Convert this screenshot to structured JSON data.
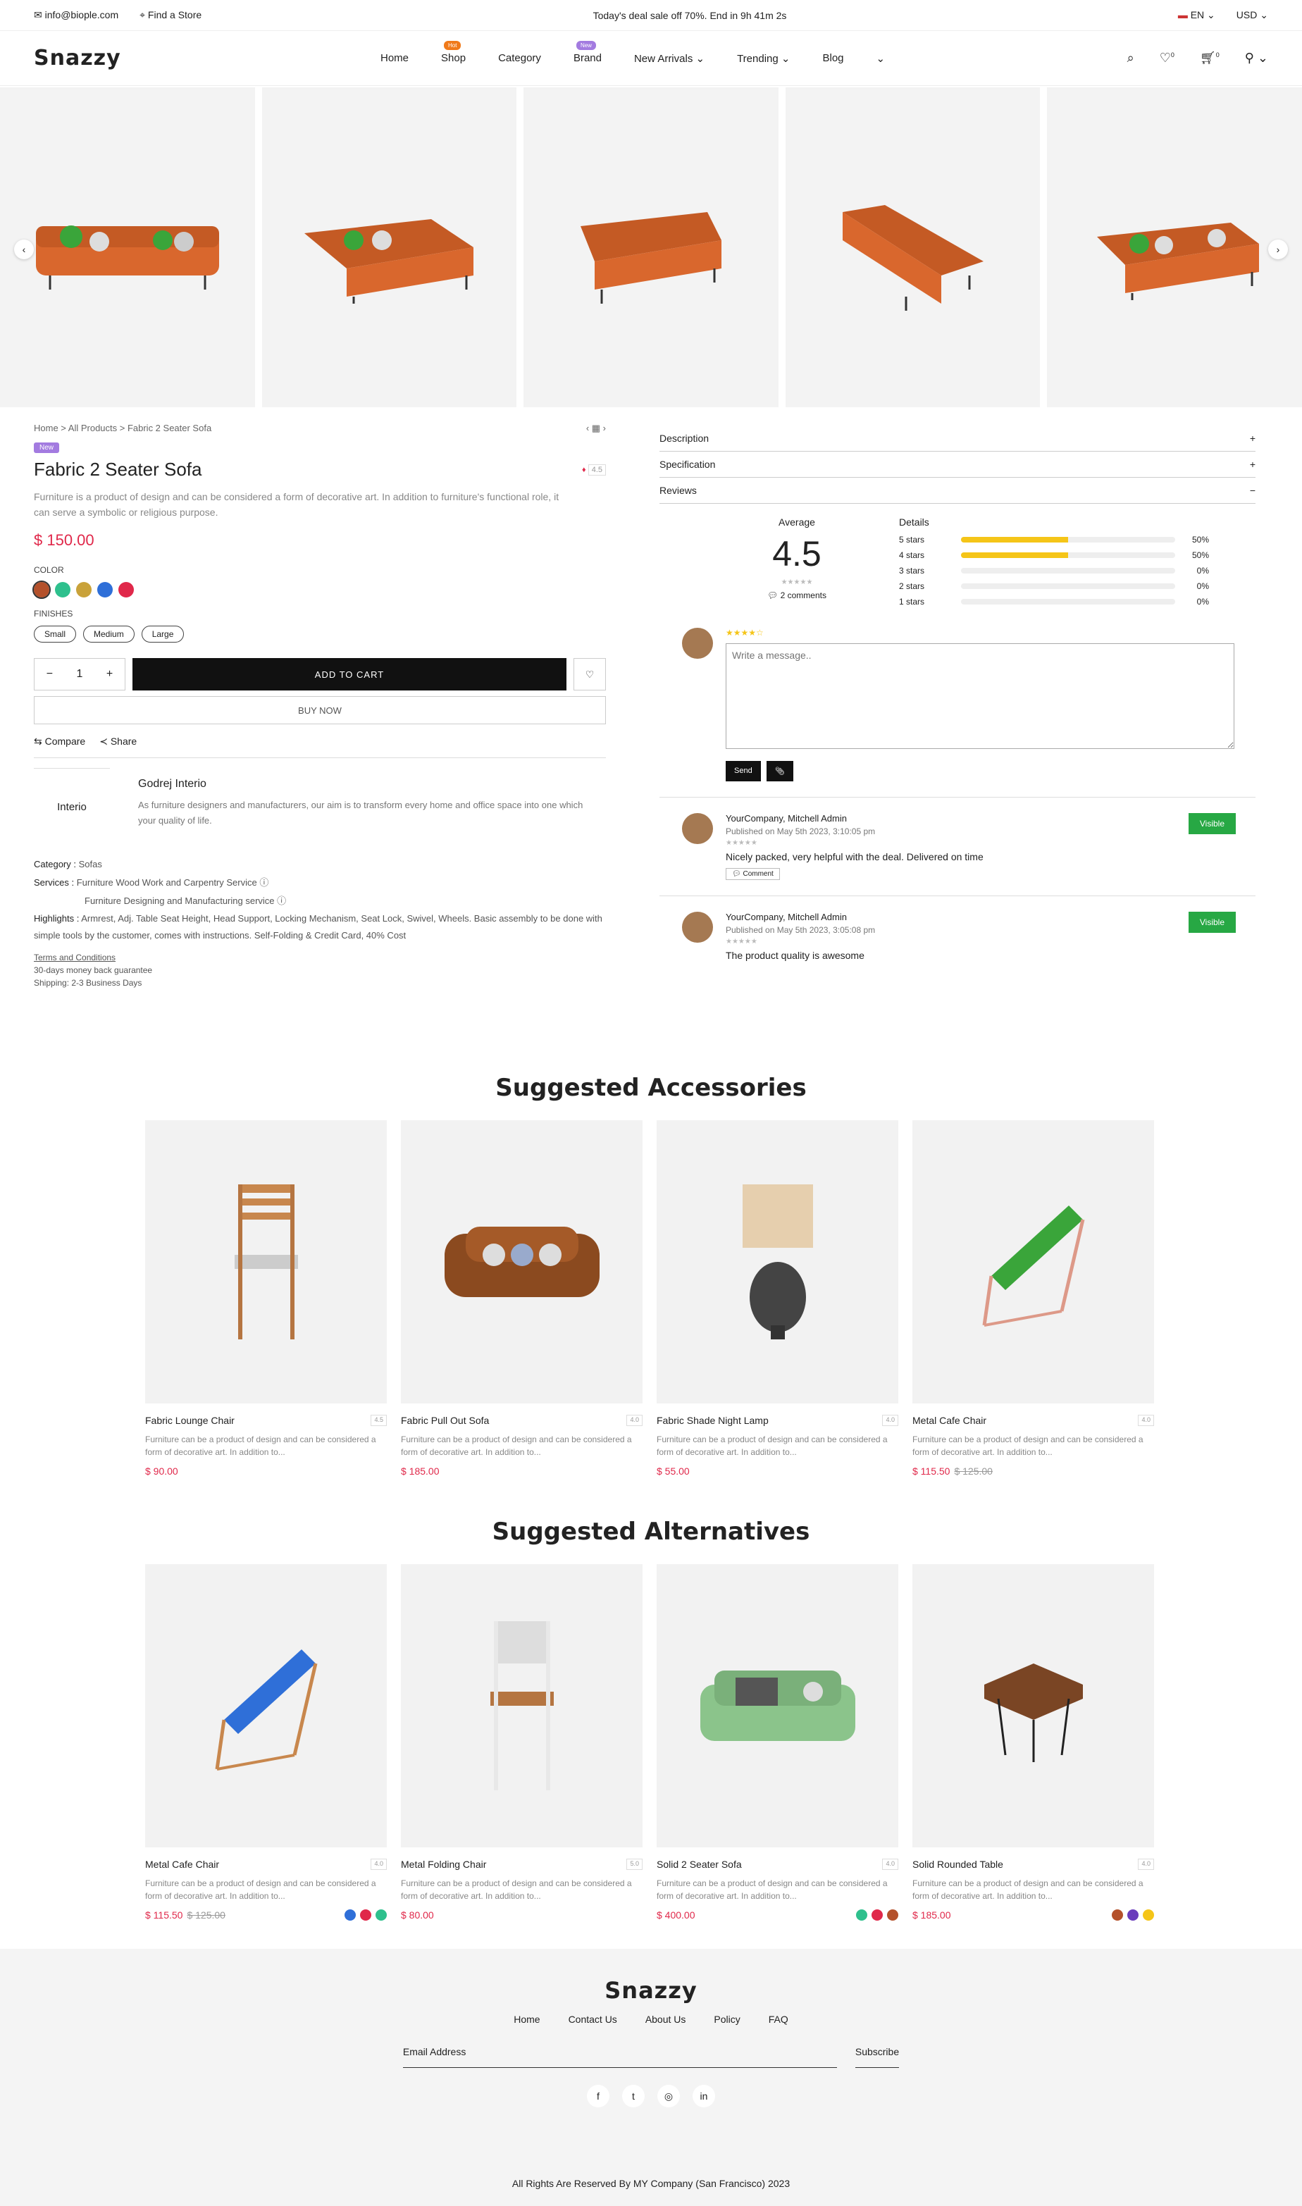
{
  "topbar": {
    "email": "info@biople.com",
    "store": "Find a Store",
    "promo": "Today's deal sale off 70%. End in 9h 41m 2s",
    "lang": "EN",
    "currency": "USD"
  },
  "nav": {
    "logo": "Snazzy",
    "menu": [
      {
        "label": "Home"
      },
      {
        "label": "Shop",
        "badge": "Hot",
        "badge_color": "#f07a1a"
      },
      {
        "label": "Category"
      },
      {
        "label": "Brand",
        "badge": "New",
        "badge_color": "#a37be0"
      },
      {
        "label": "New Arrivals"
      },
      {
        "label": "Trending"
      },
      {
        "label": "Blog"
      }
    ],
    "wishlist_count": "0",
    "cart_count": "0"
  },
  "product": {
    "breadcrumb": "Home > All Products > Fabric 2 Seater Sofa",
    "tag": "New",
    "title": "Fabric 2 Seater Sofa",
    "rating_badge": "4.5",
    "description": "Furniture is a product of design and can be considered a form of decorative art. In addition to furniture's functional role, it can serve a symbolic or religious purpose.",
    "price": "$ 150.00",
    "color_label": "COLOR",
    "colors": [
      "#b4512b",
      "#2ec08d",
      "#c9a23a",
      "#2f6fd8",
      "#e0284a"
    ],
    "size_label": "FINISHES",
    "sizes": [
      "Small",
      "Medium",
      "Large"
    ],
    "qty": "1",
    "add_to_cart": "ADD TO CART",
    "buy_now": "BUY NOW",
    "compare": "Compare",
    "share": "Share",
    "brand_logo": "Interio",
    "brand_name": "Godrej Interio",
    "brand_desc": "As furniture designers and manufacturers, our aim is to transform every home and office space into one which your quality of life.",
    "category_label": "Category :",
    "category": "Sofas",
    "services_label": "Services :",
    "services": [
      "Furniture Wood Work and Carpentry Service",
      "Furniture Designing and Manufacturing service"
    ],
    "highlights_label": "Highlights :",
    "highlights": "Armrest, Adj. Table Seat Height, Head Support, Locking Mechanism, Seat Lock, Swivel, Wheels. Basic assembly to be done with simple tools by the customer, comes with instructions. Self-Folding & Credit Card, 40% Cost",
    "terms": "Terms and Conditions",
    "guarantee": "30-days money back guarantee",
    "shipping": "Shipping: 2-3 Business Days"
  },
  "tabs": {
    "description": "Description",
    "specification": "Specification",
    "reviews": "Reviews"
  },
  "reviews": {
    "average_label": "Average",
    "average": "4.5",
    "comments": "2 comments",
    "details_label": "Details",
    "bars": [
      {
        "label": "5 stars",
        "pct": "50%",
        "value": 50
      },
      {
        "label": "4 stars",
        "pct": "50%",
        "value": 50
      },
      {
        "label": "3 stars",
        "pct": "0%",
        "value": 0
      },
      {
        "label": "2 stars",
        "pct": "0%",
        "value": 0
      },
      {
        "label": "1 stars",
        "pct": "0%",
        "value": 0
      }
    ],
    "placeholder": "Write a message..",
    "send": "Send",
    "items": [
      {
        "who": "YourCompany, Mitchell Admin",
        "published": "Published on May 5th 2023, 3:10:05 pm",
        "msg": "Nicely packed, very helpful with the deal. Delivered on time",
        "comment": "Comment",
        "visible": "Visible"
      },
      {
        "who": "YourCompany, Mitchell Admin",
        "published": "Published on May 5th 2023, 3:05:08 pm",
        "msg": "The product quality is awesome",
        "visible": "Visible"
      }
    ]
  },
  "accessories": {
    "title": "Suggested Accessories",
    "items": [
      {
        "name": "Fabric Lounge Chair",
        "rating": "4.5",
        "desc": "Furniture can be a product of design and can be considered a form of decorative art. In addition to...",
        "price": "$ 90.00"
      },
      {
        "name": "Fabric Pull Out Sofa",
        "rating": "4.0",
        "desc": "Furniture can be a product of design and can be considered a form of decorative art. In addition to...",
        "price": "$ 185.00"
      },
      {
        "name": "Fabric Shade Night Lamp",
        "rating": "4.0",
        "desc": "Furniture can be a product of design and can be considered a form of decorative art. In addition to...",
        "price": "$ 55.00"
      },
      {
        "name": "Metal Cafe Chair",
        "rating": "4.0",
        "desc": "Furniture can be a product of design and can be considered a form of decorative art. In addition to...",
        "price": "$ 115.50",
        "old": "$ 125.00"
      }
    ]
  },
  "alternatives": {
    "title": "Suggested Alternatives",
    "items": [
      {
        "name": "Metal Cafe Chair",
        "rating": "4.0",
        "desc": "Furniture can be a product of design and can be considered a form of decorative art. In addition to...",
        "price": "$ 115.50",
        "old": "$ 125.00",
        "dots": [
          "#2f6fd8",
          "#e0284a",
          "#2ec08d"
        ]
      },
      {
        "name": "Metal Folding Chair",
        "rating": "5.0",
        "desc": "Furniture can be a product of design and can be considered a form of decorative art. In addition to...",
        "price": "$ 80.00"
      },
      {
        "name": "Solid 2 Seater Sofa",
        "rating": "4.0",
        "desc": "Furniture can be a product of design and can be considered a form of decorative art. In addition to...",
        "price": "$ 400.00",
        "dots": [
          "#2ec08d",
          "#e0284a",
          "#b4512b"
        ]
      },
      {
        "name": "Solid Rounded Table",
        "rating": "4.0",
        "desc": "Furniture can be a product of design and can be considered a form of decorative art. In addition to...",
        "price": "$ 185.00",
        "dots": [
          "#b4512b",
          "#6a3cbc",
          "#f5c518"
        ]
      }
    ]
  },
  "footer": {
    "logo": "Snazzy",
    "links": [
      "Home",
      "Contact Us",
      "About Us",
      "Policy",
      "FAQ"
    ],
    "email_placeholder": "Email Address",
    "subscribe": "Subscribe",
    "copyright": "All Rights Are Reserved By MY Company (San Francisco) 2023"
  }
}
